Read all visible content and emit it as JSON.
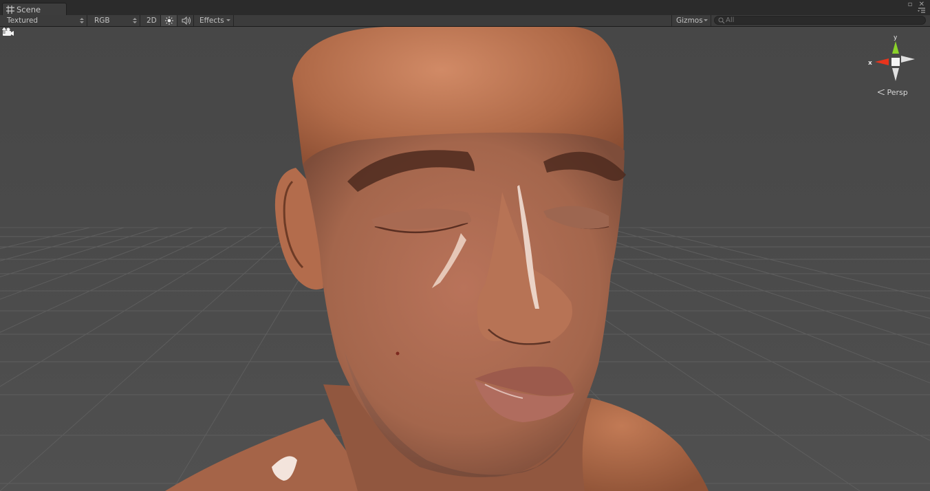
{
  "tab": {
    "title": "Scene",
    "icon": "grid-icon"
  },
  "window_controls": {
    "maximize": "▫",
    "close": "✕",
    "menu_icon": "menu-icon"
  },
  "toolbar": {
    "draw_mode": "Textured",
    "render_mode": "RGB",
    "toggle_2d": "2D",
    "lighting_icon": "sun-icon",
    "audio_icon": "speaker-icon",
    "effects": "Effects",
    "gizmos": "Gizmos",
    "search_placeholder": "All"
  },
  "gizmo": {
    "y_label": "y",
    "x_label": "x",
    "projection": "Persp"
  },
  "colors": {
    "background": "#474747",
    "grid_line": "#5c5c5c",
    "skin": "#b36a48",
    "axis_x": "#e8341c",
    "axis_y": "#8ad12a"
  }
}
